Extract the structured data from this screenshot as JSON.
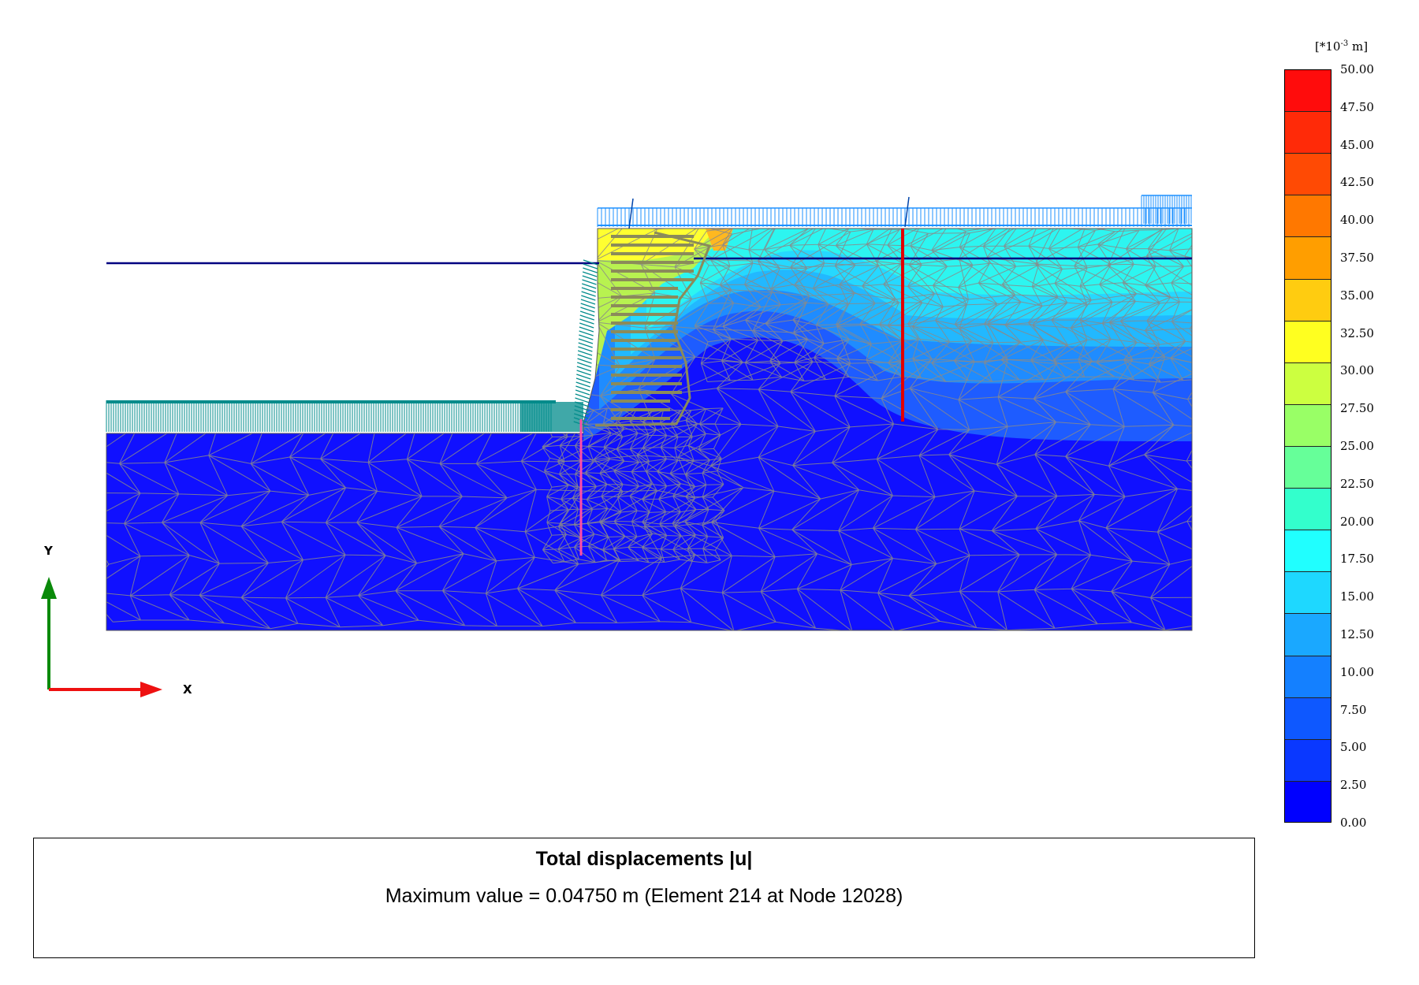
{
  "legend": {
    "unit_prefix": "[*10",
    "unit_exp": "-3",
    "unit_suffix": " m]",
    "ticks": [
      "50.00",
      "47.50",
      "45.00",
      "42.50",
      "40.00",
      "37.50",
      "35.00",
      "32.50",
      "30.00",
      "27.50",
      "25.00",
      "22.50",
      "20.00",
      "17.50",
      "15.00",
      "12.50",
      "10.00",
      "7.50",
      "5.00",
      "2.50",
      "0.00"
    ],
    "colors": [
      "#ff0c0c",
      "#ff2a08",
      "#ff4a04",
      "#ff7800",
      "#ff9e00",
      "#ffcc10",
      "#ffff20",
      "#ccff40",
      "#99ff66",
      "#66ff99",
      "#33ffcc",
      "#20ffff",
      "#1ed8ff",
      "#1aa8ff",
      "#1480ff",
      "#0e58ff",
      "#0a38ff",
      "#0000ff"
    ]
  },
  "axes": {
    "x_label": "X",
    "y_label": "Y"
  },
  "result": {
    "title": "Total displacements |u|",
    "max_line": "Maximum value = 0.04750 m (Element 214 at Node 12028)"
  },
  "field_colors": {
    "deep": "#1010ff",
    "blue": "#1e5cff",
    "mid_blue": "#1f8cff",
    "light_blue": "#22b8ff",
    "cyan": "#26d8ff",
    "aqua": "#2df5f0",
    "yellow_green": "#b8f250",
    "yellow": "#ffff30",
    "orange": "#ffb820",
    "mesh": "#8a8a8a",
    "water_line": "#000080",
    "load": "#1e90ff",
    "anchor_wall": "#008b8b",
    "reinforcement": "#8b8b5a",
    "pile_left": "#ff4da6",
    "pile_right": "#e00000"
  }
}
